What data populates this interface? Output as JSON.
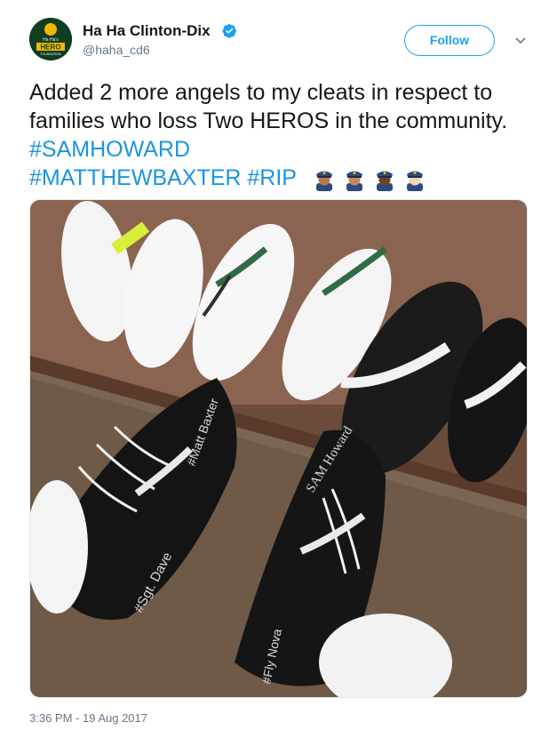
{
  "user": {
    "display_name": "Ha Ha Clinton-Dix",
    "handle": "@haha_cd6",
    "verified": true,
    "avatar_text_top": "Ha Ha's",
    "avatar_text_main": "HERO",
    "avatar_text_bottom": "FOUNDATION"
  },
  "actions": {
    "follow_label": "Follow",
    "menu_icon": "chevron-down-icon"
  },
  "tweet": {
    "text_plain": "Added 2 more angels to my cleats in respect to families who loss Two HEROS in the community.",
    "hashtags": [
      "#SAMHOWARD",
      "#MATTHEWBAXTER",
      "#RIP"
    ],
    "emojis": [
      "police-officer-emoji",
      "police-officer-emoji",
      "police-officer-emoji",
      "police-officer-emoji"
    ],
    "timestamp": "3:36 PM - 19 Aug 2017"
  },
  "media": {
    "cleat_writing_left": "#Matt Baxter",
    "cleat_writing_right": "SAM Howard",
    "cleat_writing_sgt": "#Sgt. Dave",
    "cleat_writing_bottom": "#Fly Nova"
  },
  "colors": {
    "link": "#1b95e0",
    "follow": "#1da1f2",
    "text": "#14171a",
    "secondary": "#657786"
  }
}
